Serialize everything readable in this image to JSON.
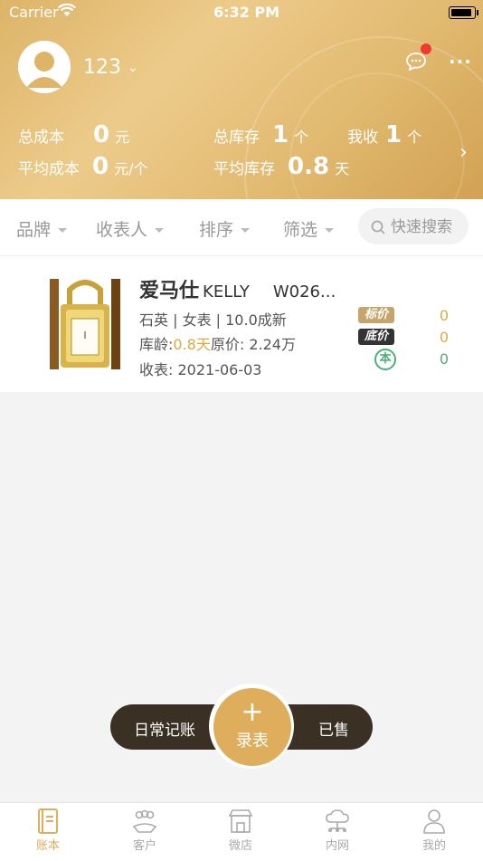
{
  "status_bar": {
    "carrier": "Carrier",
    "time": "6:32 PM"
  },
  "profile": {
    "username": "123"
  },
  "stats": {
    "total_cost_label": "总成本",
    "total_cost_value": "0",
    "total_cost_unit": "元",
    "total_stock_label": "总库存",
    "total_stock_value": "1",
    "total_stock_unit": "个",
    "my_collect_label": "我收",
    "my_collect_value": "1",
    "my_collect_unit": "个",
    "avg_cost_label": "平均成本",
    "avg_cost_value": "0",
    "avg_cost_unit": "元/个",
    "avg_stock_label": "平均库存",
    "avg_stock_value": "0.8",
    "avg_stock_unit": "天"
  },
  "filters": {
    "brand": "品牌",
    "collector": "收表人",
    "sort": "排序",
    "filter": "筛选",
    "search_placeholder": "快速搜索"
  },
  "item": {
    "brand": "爱马仕",
    "model": "KELLY",
    "ref": "W026...",
    "specs": "石英 | 女表 | 10.0成新",
    "age_label": "库龄:",
    "age_value": "0.8天",
    "original_price": "原价: 2.24万",
    "collected_date": "收表: 2021-06-03",
    "tag_list": "标价",
    "tag_floor": "底价",
    "tag_cost": "本",
    "price_list": "0",
    "price_floor": "0",
    "price_cost": "0"
  },
  "fab": {
    "left": "日常记账",
    "center": "录表",
    "right": "已售"
  },
  "tabs": [
    "账本",
    "客户",
    "微店",
    "内网",
    "我的"
  ],
  "colors": {
    "accent": "#dfae5c",
    "header": "#e2bb72",
    "fab_dark": "#3b3024",
    "cost_green": "#4caf74"
  }
}
